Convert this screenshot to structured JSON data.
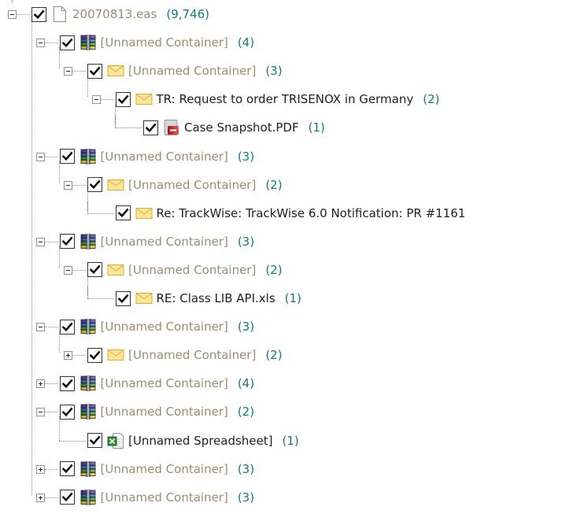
{
  "colors": {
    "unnamed_label": "#9a8e6a",
    "named_label": "#1f1f1f",
    "count": "#137a7f"
  },
  "tree": [
    {
      "label": "20070813.eas",
      "count": "(9,746)",
      "icon": "file-icon",
      "tone": "grey",
      "expander": "minus",
      "depth": 0,
      "checked": true
    },
    {
      "label": "[Unnamed Container]",
      "count": "(4)",
      "icon": "archive-icon",
      "tone": "grey",
      "expander": "minus",
      "depth": 1,
      "checked": true
    },
    {
      "label": "[Unnamed Container]",
      "count": "(3)",
      "icon": "envelope-icon",
      "tone": "grey",
      "expander": "minus",
      "depth": 2,
      "checked": true
    },
    {
      "label": "TR: Request to order TRISENOX in Germany",
      "count": "(2)",
      "icon": "envelope-icon",
      "tone": "dark",
      "expander": "minus",
      "depth": 3,
      "checked": true
    },
    {
      "label": "Case Snapshot.PDF",
      "count": "(1)",
      "icon": "pdf-icon",
      "tone": "dark",
      "expander": "leaf",
      "depth": 4,
      "checked": true
    },
    {
      "label": "[Unnamed Container]",
      "count": "(3)",
      "icon": "archive-icon",
      "tone": "grey",
      "expander": "minus",
      "depth": 1,
      "checked": true
    },
    {
      "label": "[Unnamed Container]",
      "count": "(2)",
      "icon": "envelope-icon",
      "tone": "grey",
      "expander": "minus",
      "depth": 2,
      "checked": true
    },
    {
      "label": "Re: TrackWise: TrackWise 6.0 Notification: PR #1161",
      "count": "",
      "icon": "envelope-icon",
      "tone": "dark",
      "expander": "leaf",
      "depth": 3,
      "checked": true
    },
    {
      "label": "[Unnamed Container]",
      "count": "(3)",
      "icon": "archive-icon",
      "tone": "grey",
      "expander": "minus",
      "depth": 1,
      "checked": true
    },
    {
      "label": "[Unnamed Container]",
      "count": "(2)",
      "icon": "envelope-icon",
      "tone": "grey",
      "expander": "minus",
      "depth": 2,
      "checked": true
    },
    {
      "label": "RE: Class LIB API.xls",
      "count": "(1)",
      "icon": "envelope-icon",
      "tone": "dark",
      "expander": "leaf",
      "depth": 3,
      "checked": true
    },
    {
      "label": "[Unnamed Container]",
      "count": "(3)",
      "icon": "archive-icon",
      "tone": "grey",
      "expander": "minus",
      "depth": 1,
      "checked": true
    },
    {
      "label": "[Unnamed Container]",
      "count": "(2)",
      "icon": "envelope-icon",
      "tone": "grey",
      "expander": "plus",
      "depth": 2,
      "checked": true
    },
    {
      "label": "[Unnamed Container]",
      "count": "(4)",
      "icon": "archive-icon",
      "tone": "grey",
      "expander": "plus",
      "depth": 1,
      "checked": true
    },
    {
      "label": "[Unnamed Container]",
      "count": "(2)",
      "icon": "archive-icon",
      "tone": "grey",
      "expander": "minus",
      "depth": 1,
      "checked": true
    },
    {
      "label": "[Unnamed Spreadsheet]",
      "count": "(1)",
      "icon": "spreadsheet-icon",
      "tone": "dark",
      "expander": "leaf",
      "depth": 2,
      "checked": true
    },
    {
      "label": "[Unnamed Container]",
      "count": "(3)",
      "icon": "archive-icon",
      "tone": "grey",
      "expander": "plus",
      "depth": 1,
      "checked": true
    },
    {
      "label": "[Unnamed Container]",
      "count": "(3)",
      "icon": "archive-icon",
      "tone": "grey",
      "expander": "plus",
      "depth": 1,
      "checked": true
    }
  ]
}
